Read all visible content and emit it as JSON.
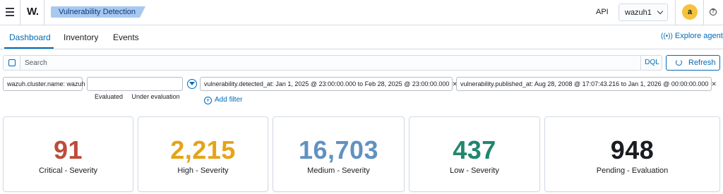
{
  "header": {
    "logo": "W.",
    "breadcrumb": "Vulnerability Detection",
    "api_label": "API",
    "env_select": "wazuh1",
    "avatar_initial": "a",
    "help_icon": "question-icon"
  },
  "tabs": [
    {
      "label": "Dashboard",
      "active": true
    },
    {
      "label": "Inventory",
      "active": false
    },
    {
      "label": "Events",
      "active": false
    }
  ],
  "explore_agent": "Explore agent",
  "search": {
    "placeholder": "Search",
    "language": "DQL",
    "refresh_label": "Refresh"
  },
  "filters": [
    {
      "label": "wazuh.cluster.name: wazuh"
    },
    {
      "label": "Evaluated     Under evaluation"
    },
    {
      "label": "vulnerability.detected_at: Jan 1, 2025 @ 23:00:00.000 to Feb 28, 2025 @ 23:00:00.000"
    },
    {
      "label": "vulnerability.published_at: Aug 28, 2008 @ 17:07:43.216 to Jan 1, 2026 @ 00:00:00.000"
    }
  ],
  "add_filter": "Add filter",
  "metrics": [
    {
      "value": "91",
      "label": "Critical - Severity",
      "color": "#bd4c3b"
    },
    {
      "value": "2,215",
      "label": "High - Severity",
      "color": "#e5a318"
    },
    {
      "value": "16,703",
      "label": "Medium - Severity",
      "color": "#6092c0"
    },
    {
      "value": "437",
      "label": "Low - Severity",
      "color": "#20876f"
    },
    {
      "value": "948",
      "label": "Pending - Evaluation",
      "color": "#1a1c21"
    }
  ],
  "colors": {
    "accent": "#006bb8",
    "breadcrumb_bg": "#a8c8f0",
    "avatar_bg": "#f5c33b"
  }
}
